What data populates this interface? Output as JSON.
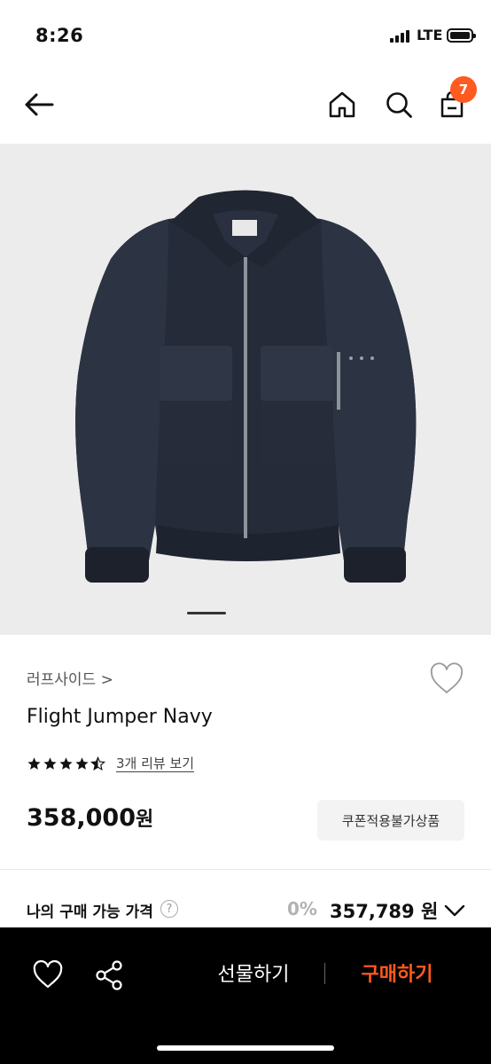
{
  "status_bar": {
    "time": "8:26",
    "network": "LTE"
  },
  "nav": {
    "cart_count": "7"
  },
  "product": {
    "brand": "러프사이드 >",
    "name": "Flight Jumper Navy",
    "rating": 4.5,
    "review_link": "3개 리뷰 보기",
    "price": "358,000",
    "price_unit": "원",
    "coupon_badge": "쿠폰적용불가상품"
  },
  "my_price": {
    "label": "나의 구매 가능 가격",
    "help": "?",
    "discount_rate": "0%",
    "price": "357,789 원"
  },
  "bottom_bar": {
    "gift_label": "선물하기",
    "buy_label": "구매하기"
  },
  "colors": {
    "accent": "#ff5a1f",
    "bottom_bar": "#000000",
    "image_bg": "#ececec"
  },
  "icons": [
    "back-arrow-icon",
    "home-icon",
    "search-icon",
    "cart-icon",
    "heart-icon",
    "star-icon",
    "question-icon",
    "chevron-down-icon",
    "share-icon"
  ]
}
